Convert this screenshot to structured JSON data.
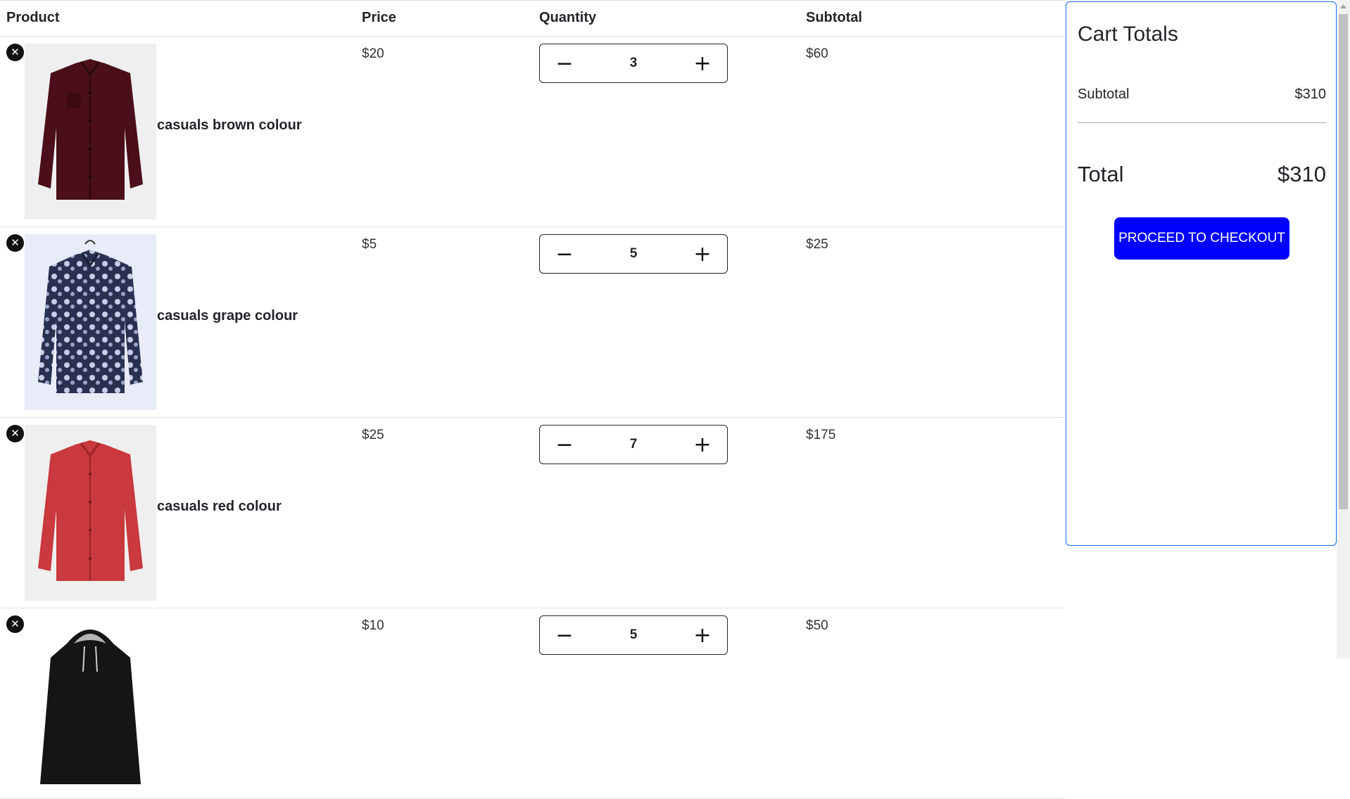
{
  "table": {
    "headers": {
      "product": "Product",
      "price": "Price",
      "quantity": "Quantity",
      "subtotal": "Subtotal"
    },
    "rows": [
      {
        "name": "casuals brown colour",
        "price": "$20",
        "quantity": "3",
        "subtotal": "$60",
        "image": "maroon-shirt"
      },
      {
        "name": "casuals grape colour",
        "price": "$5",
        "quantity": "5",
        "subtotal": "$25",
        "image": "paisley-shirt"
      },
      {
        "name": "casuals red colour",
        "price": "$25",
        "quantity": "7",
        "subtotal": "$175",
        "image": "red-shirt"
      },
      {
        "name": "",
        "price": "$10",
        "quantity": "5",
        "subtotal": "$50",
        "image": "black-hoodie"
      }
    ]
  },
  "totals": {
    "title": "Cart Totals",
    "subtotal_label": "Subtotal",
    "subtotal_value": "$310",
    "total_label": "Total",
    "total_value": "$310",
    "checkout_label": "PROCEED TO CHECKOUT"
  },
  "icons": {
    "remove": "close-icon",
    "decrement": "minus-icon",
    "increment": "plus-icon"
  },
  "colors": {
    "checkout_button": "#0000ff",
    "totals_border": "#0d6efd"
  }
}
